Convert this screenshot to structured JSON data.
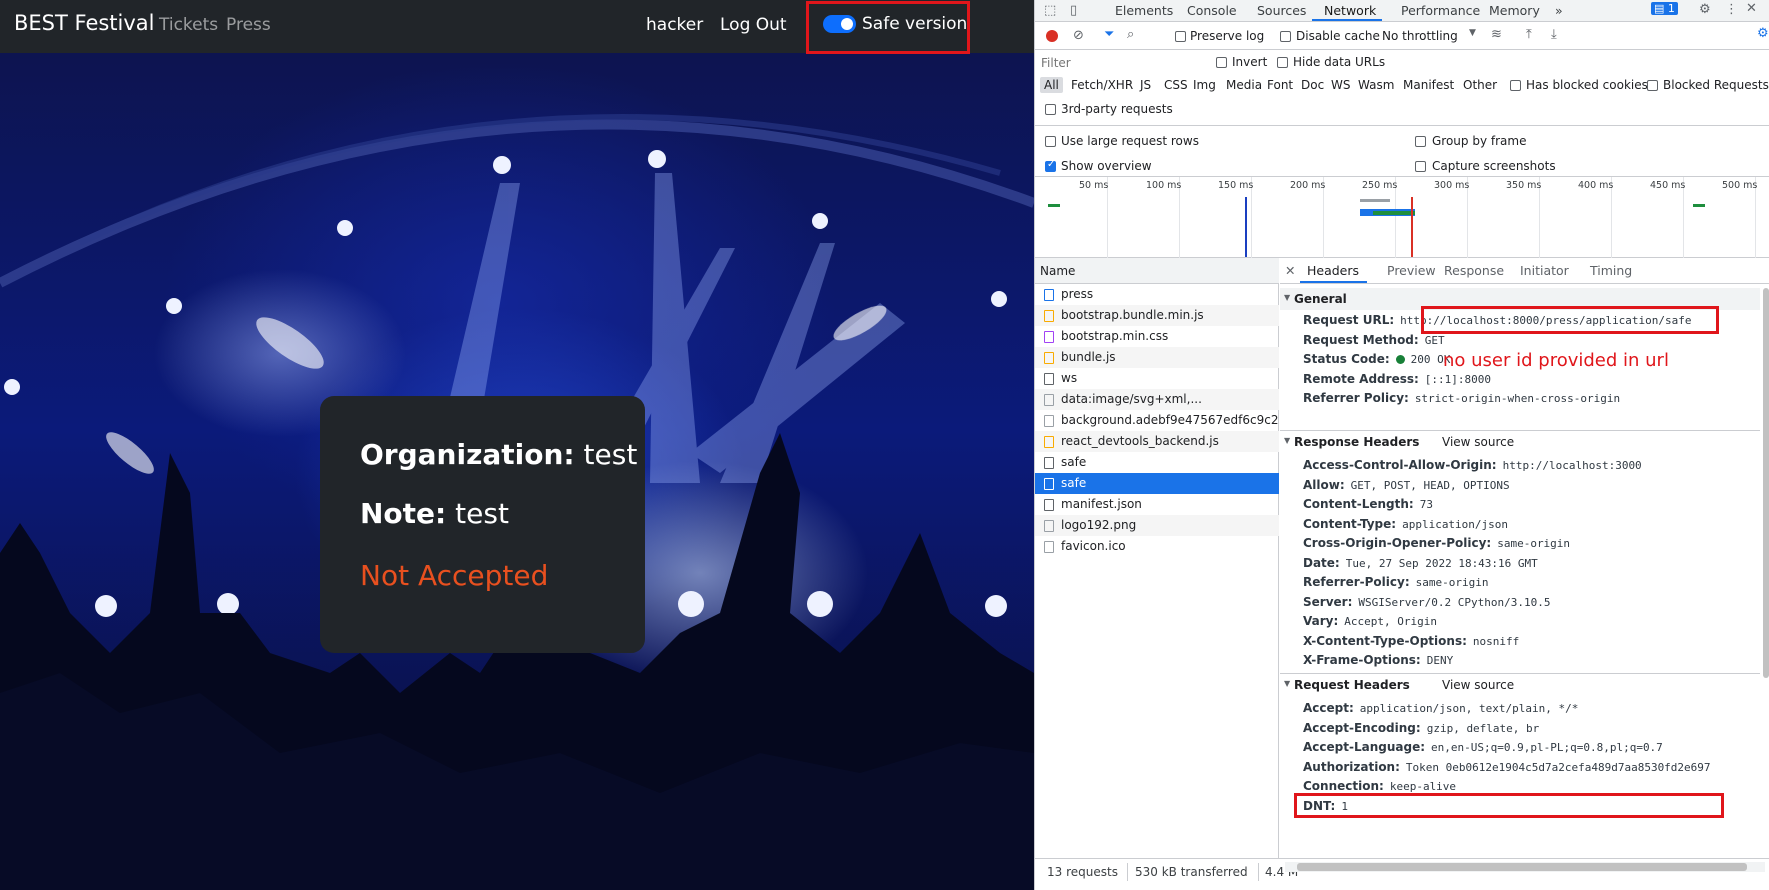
{
  "app": {
    "brand": "BEST Festival",
    "nav": [
      "Tickets",
      "Press"
    ],
    "user": "hacker",
    "logout": "Log Out",
    "toggle_label": "Safe version",
    "card": {
      "org_label": "Organization:",
      "org_value": "test",
      "note_label": "Note:",
      "note_value": "test",
      "status": "Not Accepted"
    },
    "colors": {
      "navbar": "#212529",
      "toggle": "#0d6efd",
      "status": "#e8501f",
      "highlight": "#e0161b"
    }
  },
  "devtools": {
    "tabs": [
      "Elements",
      "Console",
      "Sources",
      "Network",
      "Performance",
      "Memory"
    ],
    "more_tabs": "»",
    "active_tab": "Network",
    "issues_count": "1",
    "toolbar": {
      "preserve_log": "Preserve log",
      "disable_cache": "Disable cache",
      "throttling": "No throttling",
      "filter_placeholder": "Filter",
      "invert": "Invert",
      "hide_data_urls": "Hide data URLs",
      "types": [
        "All",
        "Fetch/XHR",
        "JS",
        "CSS",
        "Img",
        "Media",
        "Font",
        "Doc",
        "WS",
        "Wasm",
        "Manifest",
        "Other"
      ],
      "has_blocked_cookies": "Has blocked cookies",
      "blocked_requests": "Blocked Requests",
      "third_party": "3rd-party requests",
      "large_rows": "Use large request rows",
      "group_by_frame": "Group by frame",
      "show_overview": "Show overview",
      "capture_screenshots": "Capture screenshots"
    },
    "timeline_ticks": [
      "50 ms",
      "100 ms",
      "150 ms",
      "200 ms",
      "250 ms",
      "300 ms",
      "350 ms",
      "400 ms",
      "450 ms",
      "500 ms"
    ],
    "name_header": "Name",
    "requests": [
      {
        "name": "press",
        "type": "doc"
      },
      {
        "name": "bootstrap.bundle.min.js",
        "type": "js"
      },
      {
        "name": "bootstrap.min.css",
        "type": "css"
      },
      {
        "name": "bundle.js",
        "type": "js"
      },
      {
        "name": "ws",
        "type": "other"
      },
      {
        "name": "data:image/svg+xml,...",
        "type": "img"
      },
      {
        "name": "background.adebf9e47567edf6c9c2....",
        "type": "img"
      },
      {
        "name": "react_devtools_backend.js",
        "type": "js"
      },
      {
        "name": "safe",
        "type": "fetch"
      },
      {
        "name": "safe",
        "type": "fetch",
        "selected": true
      },
      {
        "name": "manifest.json",
        "type": "other"
      },
      {
        "name": "logo192.png",
        "type": "img"
      },
      {
        "name": "favicon.ico",
        "type": "img"
      }
    ],
    "detail_tabs": [
      "Headers",
      "Preview",
      "Response",
      "Initiator",
      "Timing"
    ],
    "general": {
      "title": "General",
      "rows": [
        {
          "k": "Request URL:",
          "v": "http://localhost:8000/press/application/safe"
        },
        {
          "k": "Request Method:",
          "v": "GET"
        },
        {
          "k": "Status Code:",
          "v": "200 OK"
        },
        {
          "k": "Remote Address:",
          "v": "[::1]:8000"
        },
        {
          "k": "Referrer Policy:",
          "v": "strict-origin-when-cross-origin"
        }
      ]
    },
    "annotation": "no user id provided in url",
    "response_headers": {
      "title": "Response Headers",
      "view_source": "View source",
      "rows": [
        {
          "k": "Access-Control-Allow-Origin:",
          "v": "http://localhost:3000"
        },
        {
          "k": "Allow:",
          "v": "GET, POST, HEAD, OPTIONS"
        },
        {
          "k": "Content-Length:",
          "v": "73"
        },
        {
          "k": "Content-Type:",
          "v": "application/json"
        },
        {
          "k": "Cross-Origin-Opener-Policy:",
          "v": "same-origin"
        },
        {
          "k": "Date:",
          "v": "Tue, 27 Sep 2022 18:43:16 GMT"
        },
        {
          "k": "Referrer-Policy:",
          "v": "same-origin"
        },
        {
          "k": "Server:",
          "v": "WSGIServer/0.2 CPython/3.10.5"
        },
        {
          "k": "Vary:",
          "v": "Accept, Origin"
        },
        {
          "k": "X-Content-Type-Options:",
          "v": "nosniff"
        },
        {
          "k": "X-Frame-Options:",
          "v": "DENY"
        }
      ]
    },
    "request_headers": {
      "title": "Request Headers",
      "view_source": "View source",
      "rows": [
        {
          "k": "Accept:",
          "v": "application/json, text/plain, */*"
        },
        {
          "k": "Accept-Encoding:",
          "v": "gzip, deflate, br"
        },
        {
          "k": "Accept-Language:",
          "v": "en,en-US;q=0.9,pl-PL;q=0.8,pl;q=0.7"
        },
        {
          "k": "Authorization:",
          "v": "Token 0eb0612e1904c5d7a2cefa489d7aa8530fd2e697"
        },
        {
          "k": "Connection:",
          "v": "keep-alive"
        },
        {
          "k": "DNT:",
          "v": "1"
        }
      ]
    },
    "statusbar": {
      "requests": "13 requests",
      "transferred": "530 kB transferred",
      "resources": "4.4 M"
    }
  }
}
